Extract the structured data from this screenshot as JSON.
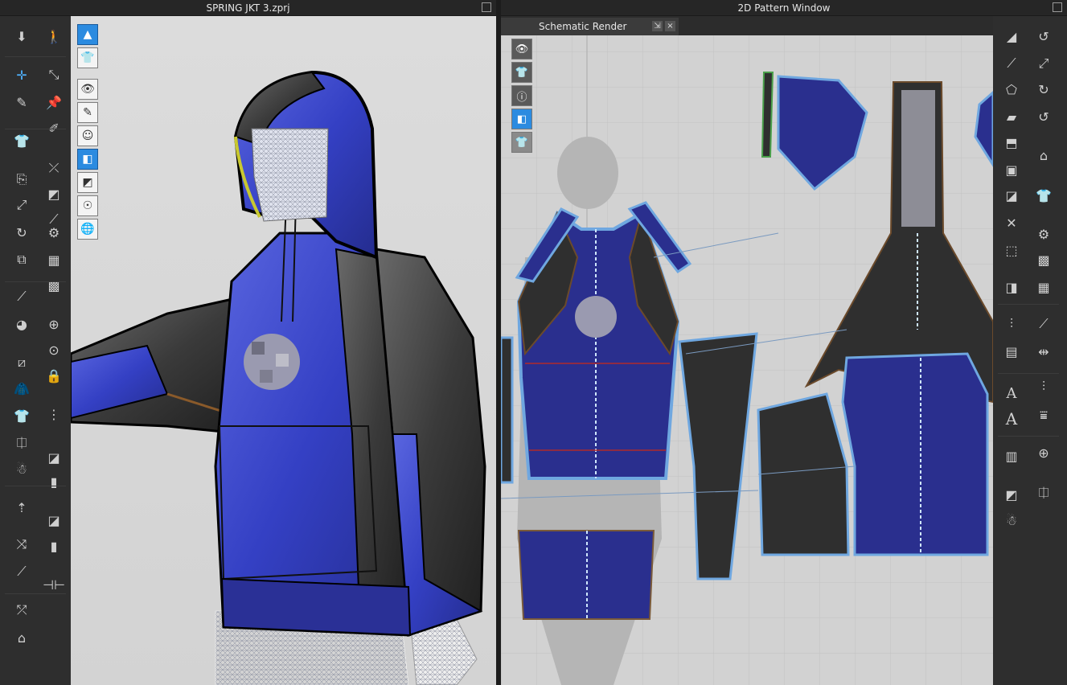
{
  "windows": {
    "viewport_3d_title": "SPRING JKT 3.zprj",
    "pattern_2d_title": "2D Pattern Window"
  },
  "pattern_window": {
    "active_tab": "Schematic Render",
    "tab_pin_label": "⇲",
    "tab_close_label": "×"
  },
  "left_toolbar": {
    "items": [
      "arrow-down-icon",
      "avatar-walk-icon",
      "select-move-icon",
      "fold-arrangement-icon",
      "brush-icon",
      "pin-icon",
      "garment-icon",
      "tack-icon",
      "shirt-edit-icon",
      "measure-icon",
      "hanger-icon",
      "button-icon",
      "zipper-icon",
      "topstitch-icon",
      "sewing-icon",
      "puckering-icon"
    ]
  },
  "viewport_3d_overlay": {
    "icons": [
      "show-avatar-icon",
      "show-garment-icon",
      "eye-garment-icon",
      "eye-brush-icon",
      "eye-avatar-icon",
      "texture-view-icon",
      "thick-view-icon",
      "xray-icon",
      "mesh-view-icon"
    ]
  },
  "pattern_overlay": {
    "icons": [
      "eye-garment-icon",
      "info-icon",
      "texture-icon",
      "lock-garment-icon"
    ]
  },
  "right_toolbar": {
    "text_tool_labels": [
      "A",
      "A"
    ]
  },
  "colors": {
    "panel_bg": "#2e2e2e",
    "viewport_bg": "#d8d8d8",
    "pattern_bg": "#d2d2d2",
    "fabric_blue": "#2a2f8e",
    "fabric_black": "#2f2f2f",
    "selection_blue": "#2b8be0"
  }
}
